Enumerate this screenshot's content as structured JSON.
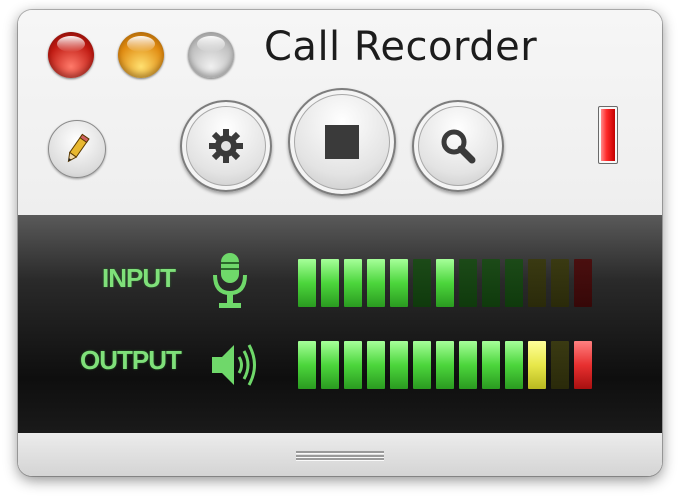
{
  "window": {
    "title": "Call Recorder"
  },
  "window_controls": {
    "close": "close-icon",
    "minimize": "minimize-icon",
    "zoom": "zoom-icon"
  },
  "toolbar": {
    "edit_icon": "pencil-icon",
    "settings_icon": "gear-icon",
    "stop_icon": "stop-icon",
    "search_icon": "magnifier-icon",
    "recording_indicator_color": "#ff2a2a"
  },
  "meters": {
    "input": {
      "label": "INPUT",
      "icon": "microphone-icon",
      "segments": [
        "g-on",
        "g-on",
        "g-on",
        "g-on",
        "g-on",
        "g-off",
        "g-on",
        "g-off",
        "g-off",
        "g-off",
        "y-off",
        "y-off",
        "r-off"
      ]
    },
    "output": {
      "label": "OUTPUT",
      "icon": "speaker-icon",
      "segments": [
        "g-on",
        "g-on",
        "g-on",
        "g-on",
        "g-on",
        "g-on",
        "g-on",
        "g-on",
        "g-on",
        "g-on",
        "y-on",
        "y-off",
        "r-on"
      ]
    },
    "colors": {
      "label": "#7fe07a",
      "green_on": "#4cd63c",
      "yellow_on": "#e8e84a",
      "red_on": "#e83030"
    }
  }
}
